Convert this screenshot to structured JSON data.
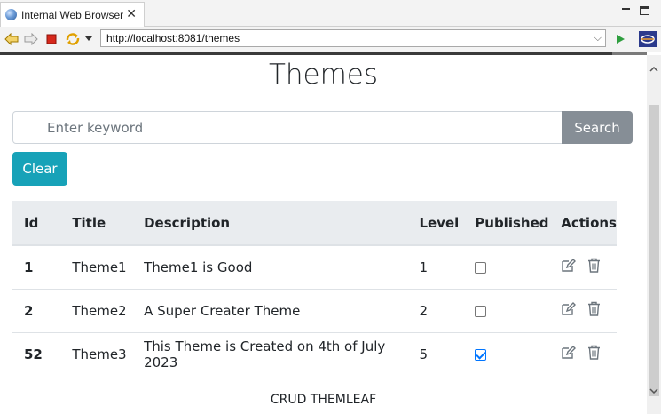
{
  "browser": {
    "tab_title": "Internal Web Browser",
    "url": "http://localhost:8081/themes"
  },
  "page": {
    "title": "Themes",
    "search_placeholder": "Enter keyword",
    "search_label": "Search",
    "clear_label": "Clear",
    "footer": "CRUD THEMLEAF"
  },
  "table": {
    "headers": [
      "Id",
      "Title",
      "Description",
      "Level",
      "Published",
      "Actions"
    ],
    "rows": [
      {
        "id": "1",
        "title": "Theme1",
        "description": "Theme1 is Good",
        "level": "1",
        "published": false
      },
      {
        "id": "2",
        "title": "Theme2",
        "description": "A Super Creater Theme",
        "level": "2",
        "published": false
      },
      {
        "id": "52",
        "title": "Theme3",
        "description": "This Theme is Created on 4th of July 2023",
        "level": "5",
        "published": true
      }
    ]
  },
  "colors": {
    "search_button": "#868e96",
    "clear_button": "#17a2b8",
    "table_header": "#e9ecef",
    "checkbox_checked": "#0075ff"
  },
  "icons": {
    "row_actions": [
      "edit-icon",
      "delete-icon"
    ]
  }
}
